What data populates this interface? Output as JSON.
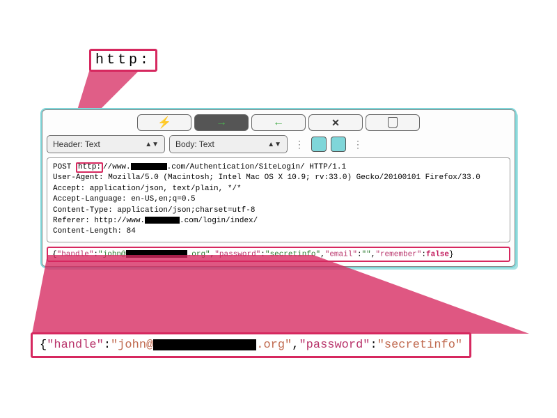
{
  "callouts": {
    "top_text": "http:",
    "bottom_prefix": "{",
    "bottom_k1": "\"handle\"",
    "bottom_v1a": "\"john@",
    "bottom_v1b": ".org\"",
    "bottom_k2": "\"password\"",
    "bottom_v2": "\"secretinfo\""
  },
  "toolbar": {
    "bolt": "bolt",
    "right": "right-arrow",
    "left": "left-arrow",
    "close": "close",
    "scroll": "scroll"
  },
  "controls": {
    "select1": "Header: Text",
    "select2": "Body: Text"
  },
  "request": {
    "method": "POST",
    "scheme": "http:",
    "url_rest": "//www.",
    "url_after": ".com/Authentication/SiteLogin/ HTTP/1.1",
    "ua": "User-Agent: Mozilla/5.0 (Macintosh; Intel Mac OS X 10.9; rv:33.0) Gecko/20100101 Firefox/33.0",
    "accept": "Accept: application/json, text/plain, */*",
    "accept_lang": "Accept-Language: en-US,en;q=0.5",
    "ctype": "Content-Type: application/json;charset=utf-8",
    "referer_pre": "Referer: http://www.",
    "referer_post": ".com/login/index/",
    "clen": "Content-Length: 84"
  },
  "body": {
    "brace_open": "{",
    "k_handle": "\"handle\"",
    "v_handle_pre": "\"john@",
    "v_handle_post": ".org\"",
    "k_password": "\"password\"",
    "v_password": "\"secretinfo\"",
    "k_email": "\"email\"",
    "v_email": "\"\"",
    "k_remember": "\"remember\"",
    "v_remember": "false",
    "brace_close": "}"
  },
  "colors": {
    "highlight": "#d6285f",
    "teal": "#7fd6d9"
  }
}
